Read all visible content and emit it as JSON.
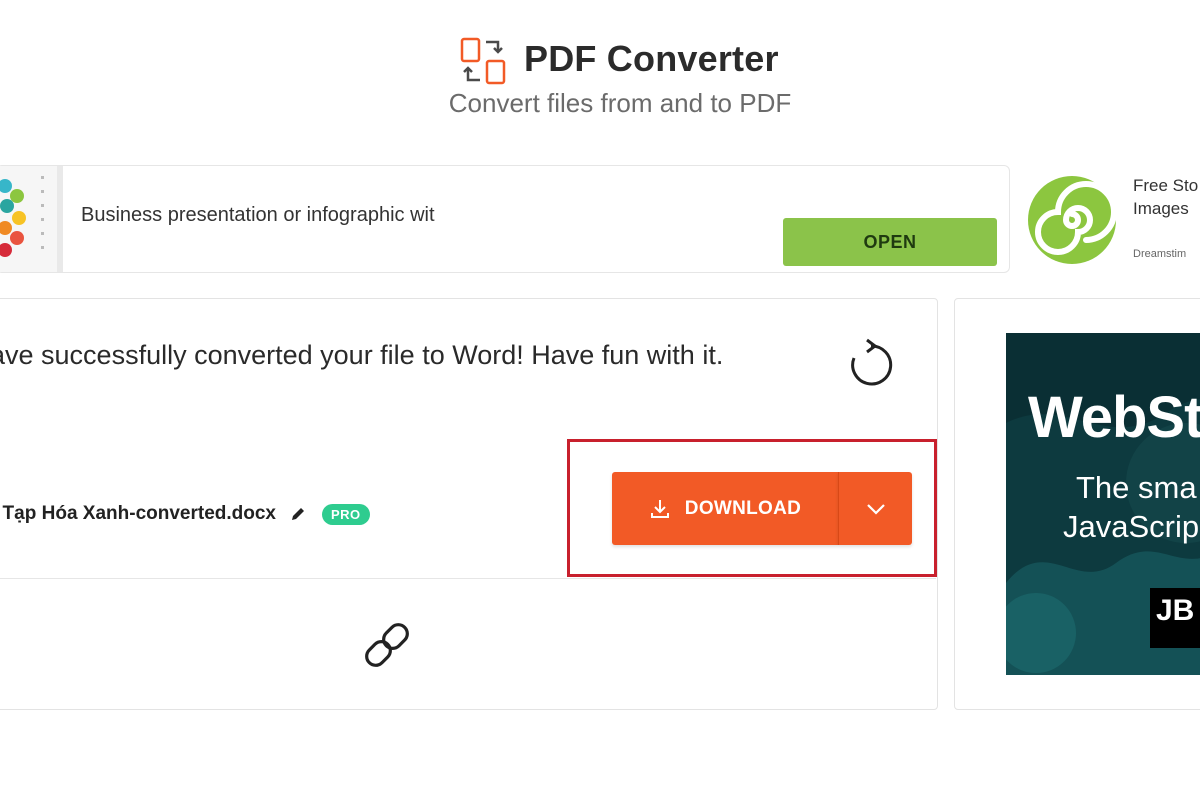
{
  "header": {
    "title": "PDF Converter",
    "subtitle": "Convert files from and to PDF",
    "brand_color": "#f25a26"
  },
  "ad_banner": {
    "text": "Business presentation or infographic wit",
    "open_label": "OPEN",
    "open_color": "#8bc34a"
  },
  "ad_side_top": {
    "title_line1": "Free Sto",
    "title_line2": "Images",
    "brand": "Dreamstim"
  },
  "conversion": {
    "message": "ave successfully converted your file to Word! Have fun with it.",
    "file_name": "ị Tạp Hóa Xanh-converted.docx",
    "pro_badge": "PRO",
    "download_label": "DOWNLOAD",
    "highlight_color": "#c8202d"
  },
  "side_ad": {
    "title": "WebSt",
    "line1": "The sma",
    "line2": "JavaScrip",
    "logo": "JB"
  },
  "icons": {
    "logo": "convert-arrows-icon",
    "refresh": "refresh-icon",
    "edit": "pencil-icon",
    "download": "download-icon",
    "dropdown": "chevron-down-icon",
    "link": "link-icon"
  }
}
